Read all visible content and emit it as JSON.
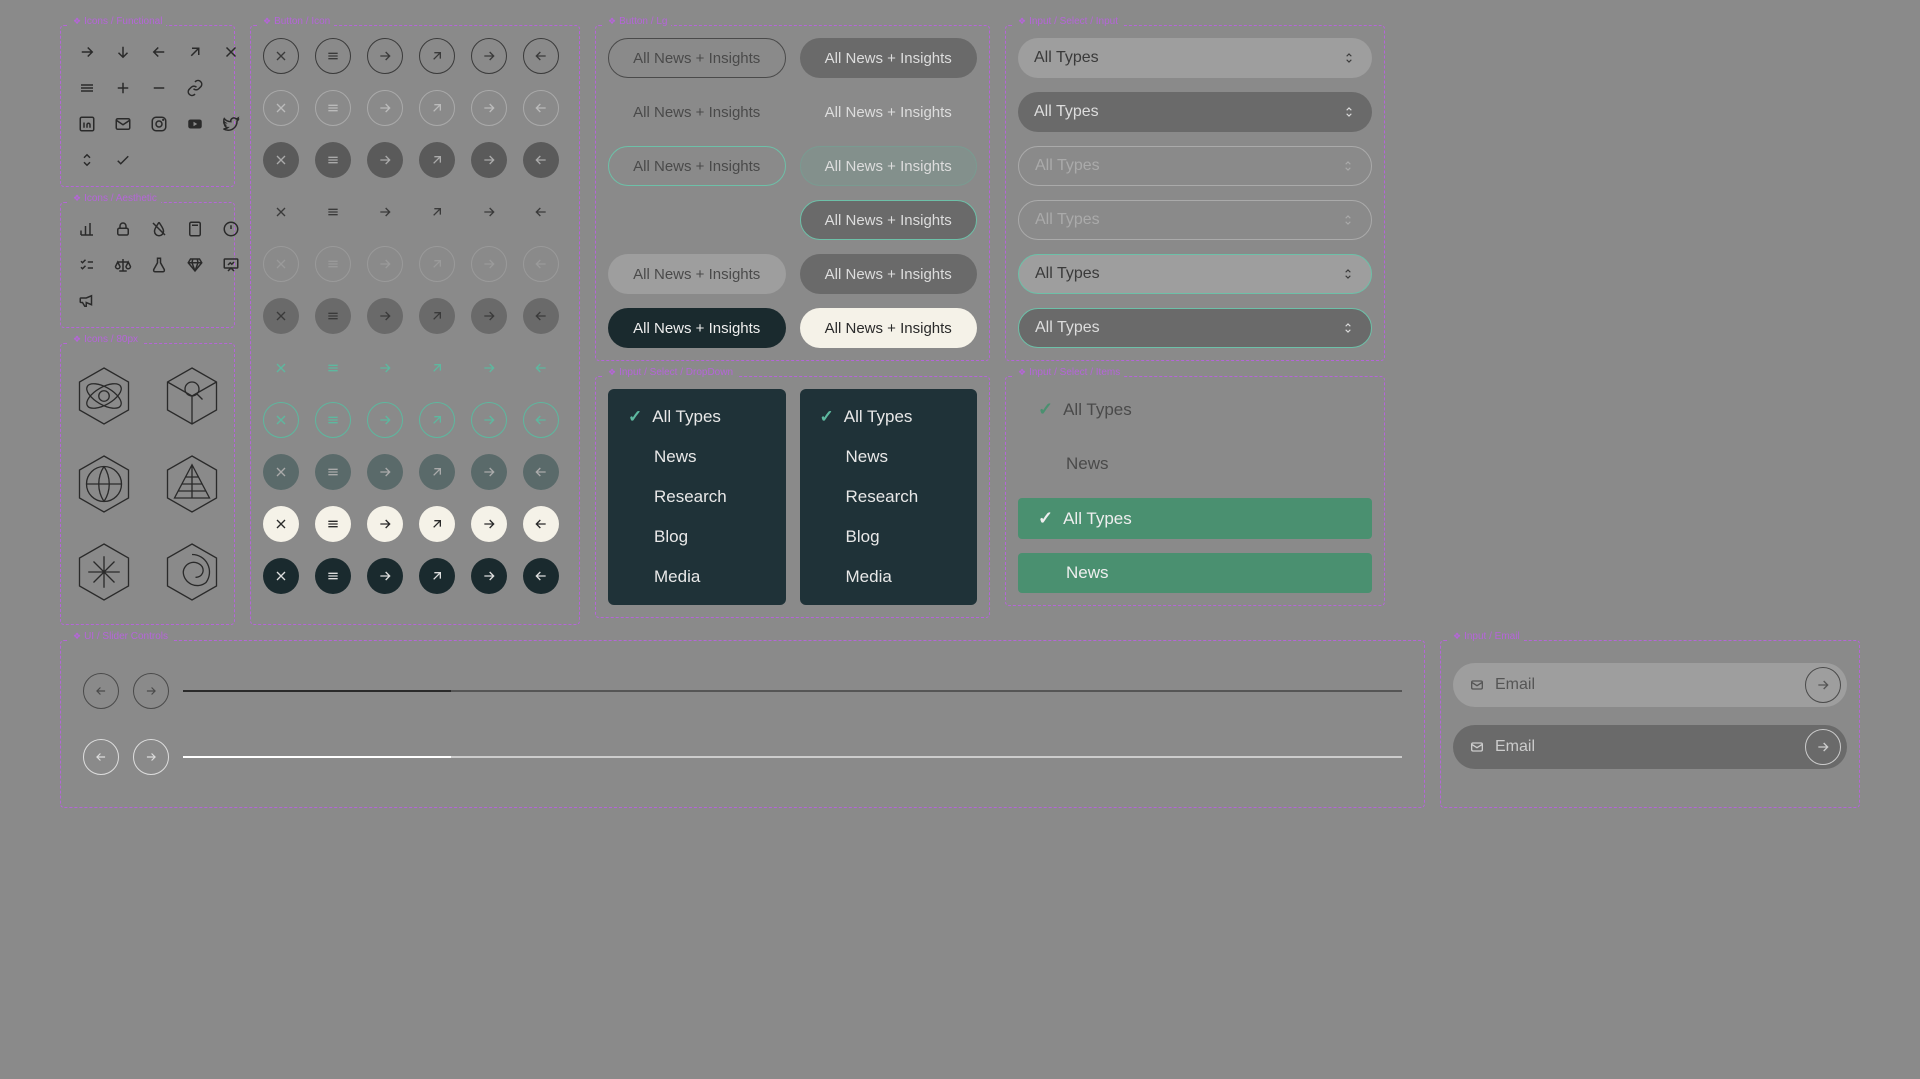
{
  "sections": {
    "functional": "Icons / Functional",
    "aesthetic": "Icons / Aesthetic",
    "px80": "Icons / 80px",
    "buttonIcon": "Button / Icon",
    "buttonLg": "Button / Lg",
    "selectInput": "Input / Select / Input",
    "dropdown": "Input / Select / DropDown",
    "selectItems": "Input / Select / Items",
    "slider": "UI / Slider Controls",
    "email": "Input / Email"
  },
  "buttonLg": {
    "label": "All News + Insights"
  },
  "select": {
    "label": "All Types"
  },
  "dropdownItems": [
    "All Types",
    "News",
    "Research",
    "Blog",
    "Media"
  ],
  "selectItems": {
    "row1": "All Types",
    "row2": "News",
    "row3": "All Types",
    "row4": "News"
  },
  "email": {
    "placeholder": "Email"
  }
}
